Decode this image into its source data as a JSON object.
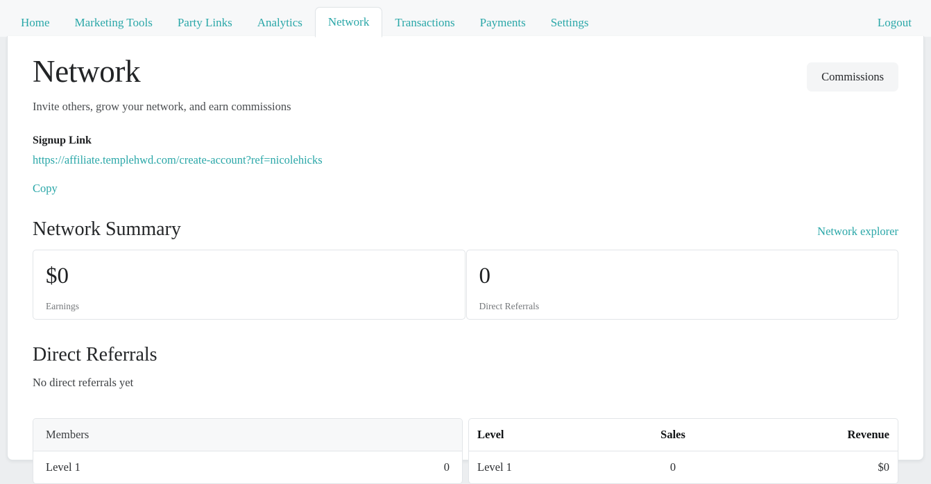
{
  "nav": {
    "tabs": [
      {
        "label": "Home",
        "active": false
      },
      {
        "label": "Marketing Tools",
        "active": false
      },
      {
        "label": "Party Links",
        "active": false
      },
      {
        "label": "Analytics",
        "active": false
      },
      {
        "label": "Network",
        "active": true
      },
      {
        "label": "Transactions",
        "active": false
      },
      {
        "label": "Payments",
        "active": false
      },
      {
        "label": "Settings",
        "active": false
      }
    ],
    "logout_label": "Logout",
    "link_color": "#2aa7a8"
  },
  "page": {
    "title": "Network",
    "subtitle": "Invite others, grow your network, and earn commissions",
    "commissions_button": "Commissions"
  },
  "signup": {
    "label": "Signup Link",
    "url": "https://affiliate.templehwd.com/create-account?ref=nicolehicks",
    "copy_label": "Copy"
  },
  "summary": {
    "title": "Network Summary",
    "explorer_link": "Network explorer",
    "stats": [
      {
        "value": "$0",
        "label": "Earnings"
      },
      {
        "value": "0",
        "label": "Direct Referrals"
      }
    ]
  },
  "referrals": {
    "title": "Direct Referrals",
    "empty_text": "No direct referrals yet"
  },
  "members_table": {
    "header": "Members",
    "rows": [
      {
        "level": "Level 1",
        "count": "0"
      }
    ]
  },
  "levels_table": {
    "headers": {
      "level": "Level",
      "sales": "Sales",
      "revenue": "Revenue"
    },
    "rows": [
      {
        "level": "Level 1",
        "sales": "0",
        "revenue": "$0"
      }
    ]
  }
}
